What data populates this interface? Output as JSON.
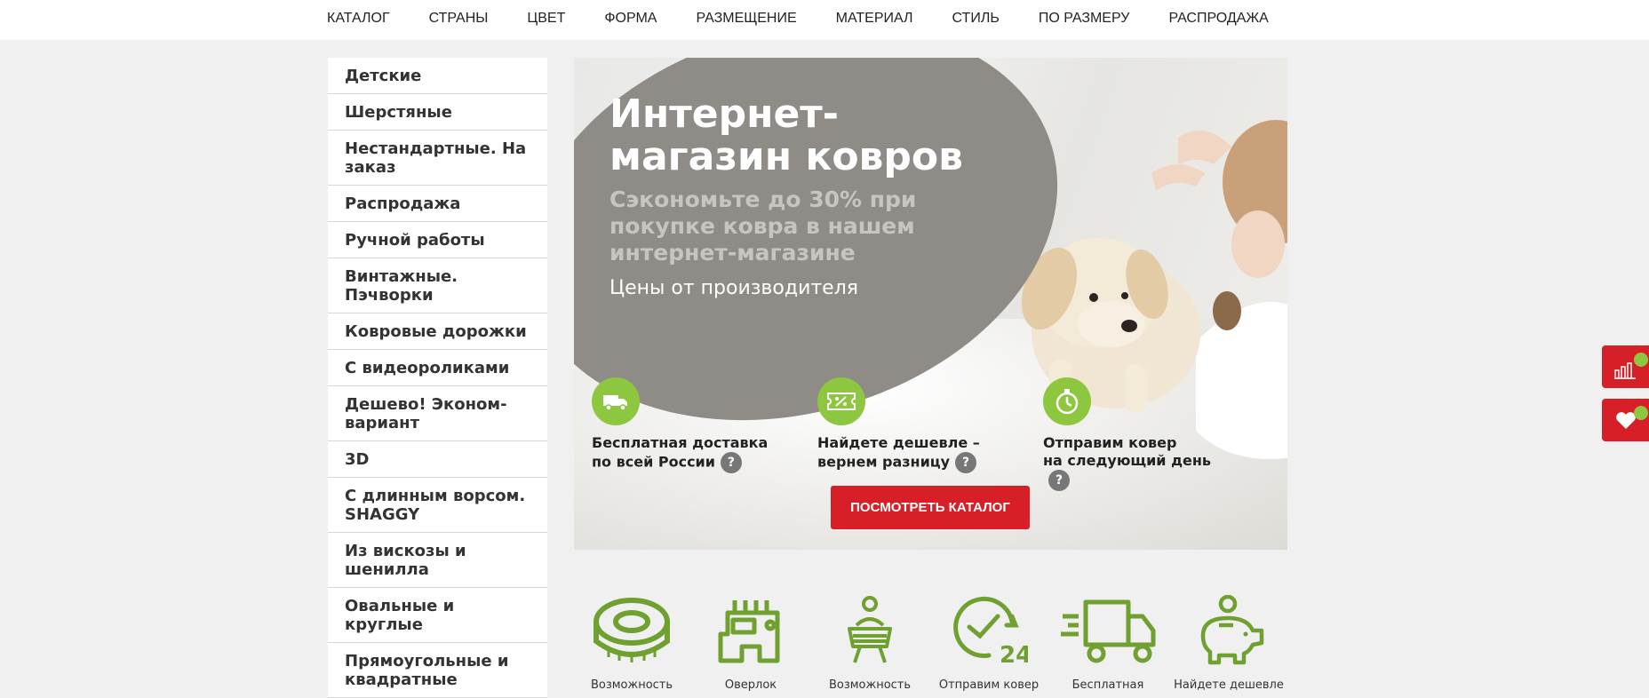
{
  "topnav": {
    "items": [
      "КАТАЛОГ",
      "СТРАНЫ",
      "ЦВЕТ",
      "ФОРМА",
      "РАЗМЕЩЕНИЕ",
      "МАТЕРИАЛ",
      "СТИЛЬ",
      "ПО РАЗМЕРУ",
      "РАСПРОДАЖА"
    ]
  },
  "sidebar": {
    "items": [
      "Детские",
      "Шерстяные",
      "Нестандартные. На заказ",
      "Распродажа",
      "Ручной работы",
      "Винтажные. Пэчворки",
      "Ковровые дорожки",
      "С видеороликами",
      "Дешево! Эконом-вариант",
      "3D",
      "С длинным ворсом. SHAGGY",
      "Из вискозы и шенилла",
      "Овальные и круглые",
      "Прямоугольные и квадратные"
    ]
  },
  "hero": {
    "title": "Интернет-магазин ковров",
    "subtitle": "Сэкономьте до 30% при покупке ковра в нашем интернет-магазине",
    "price_note": "Цены от производителя",
    "features": [
      {
        "line1": "Бесплатная доставка",
        "line2": "по всей России",
        "icon": "truck-icon"
      },
      {
        "line1": "Найдете дешевле –",
        "line2": "вернем разницу",
        "icon": "discount-coupon-icon"
      },
      {
        "line1": "Отправим ковер",
        "line2": "на следующий день",
        "icon": "stopwatch-icon"
      }
    ],
    "help_mark": "?",
    "cta_label": "ПОСМОТРЕТЬ КАТАЛОГ"
  },
  "bottom_features": {
    "items": [
      {
        "label": "Возможность",
        "icon": "measuring-tape-icon"
      },
      {
        "label": "Оверлок",
        "icon": "overlock-machine-icon"
      },
      {
        "label": "Возможность",
        "icon": "person-carpet-icon"
      },
      {
        "label": "Отправим ковер",
        "icon": "clock-24-icon"
      },
      {
        "label": "Бесплатная",
        "icon": "delivery-truck-icon"
      },
      {
        "label": "Найдете дешевле",
        "icon": "piggy-bank-icon"
      }
    ]
  },
  "colors": {
    "accent_green": "#8dc63f",
    "icon_green": "#6fa030",
    "cta_red": "#d61f26",
    "blob_gray": "#8f8b86"
  }
}
